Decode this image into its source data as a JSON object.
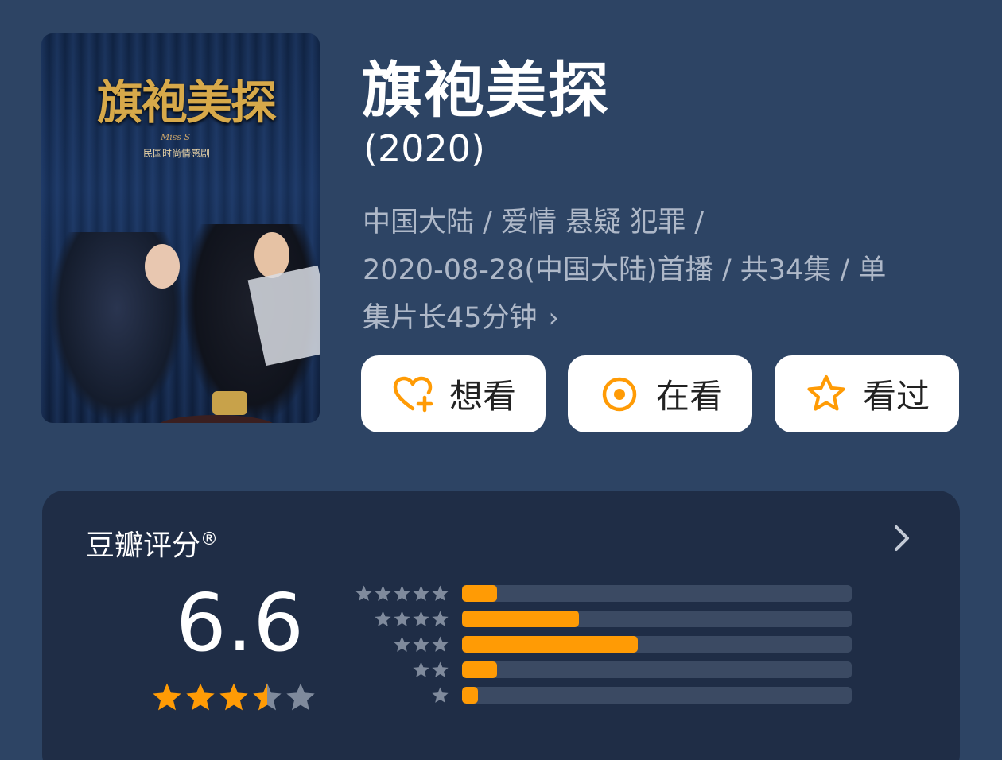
{
  "poster": {
    "title_text": "旗袍美探",
    "subtitle_en": "Miss S",
    "subtitle_cn": "民国时尚情感剧"
  },
  "show": {
    "title": "旗袍美探",
    "year": "(2020)",
    "meta_line1": "中国大陆 / 爱情 悬疑 犯罪 /",
    "meta_line2": "2020-08-28(中国大陆)首播 / 共34集 / 单",
    "meta_line3": "集片长45分钟",
    "meta_chevron": "›"
  },
  "actions": {
    "want_label": "想看",
    "watching_label": "在看",
    "watched_label": "看过",
    "icon_color": "#ff9b05"
  },
  "rating": {
    "label": "豆瓣评分",
    "registered_mark": "®",
    "score": "6.6",
    "stars_value": 3.5,
    "stars_max": 5,
    "distribution": [
      {
        "stars": 5,
        "fraction": 0.09
      },
      {
        "stars": 4,
        "fraction": 0.3
      },
      {
        "stars": 3,
        "fraction": 0.45
      },
      {
        "stars": 2,
        "fraction": 0.09
      },
      {
        "stars": 1,
        "fraction": 0.04
      }
    ],
    "accent_color": "#ff9b05",
    "muted_star_color": "#7f8a9c"
  }
}
